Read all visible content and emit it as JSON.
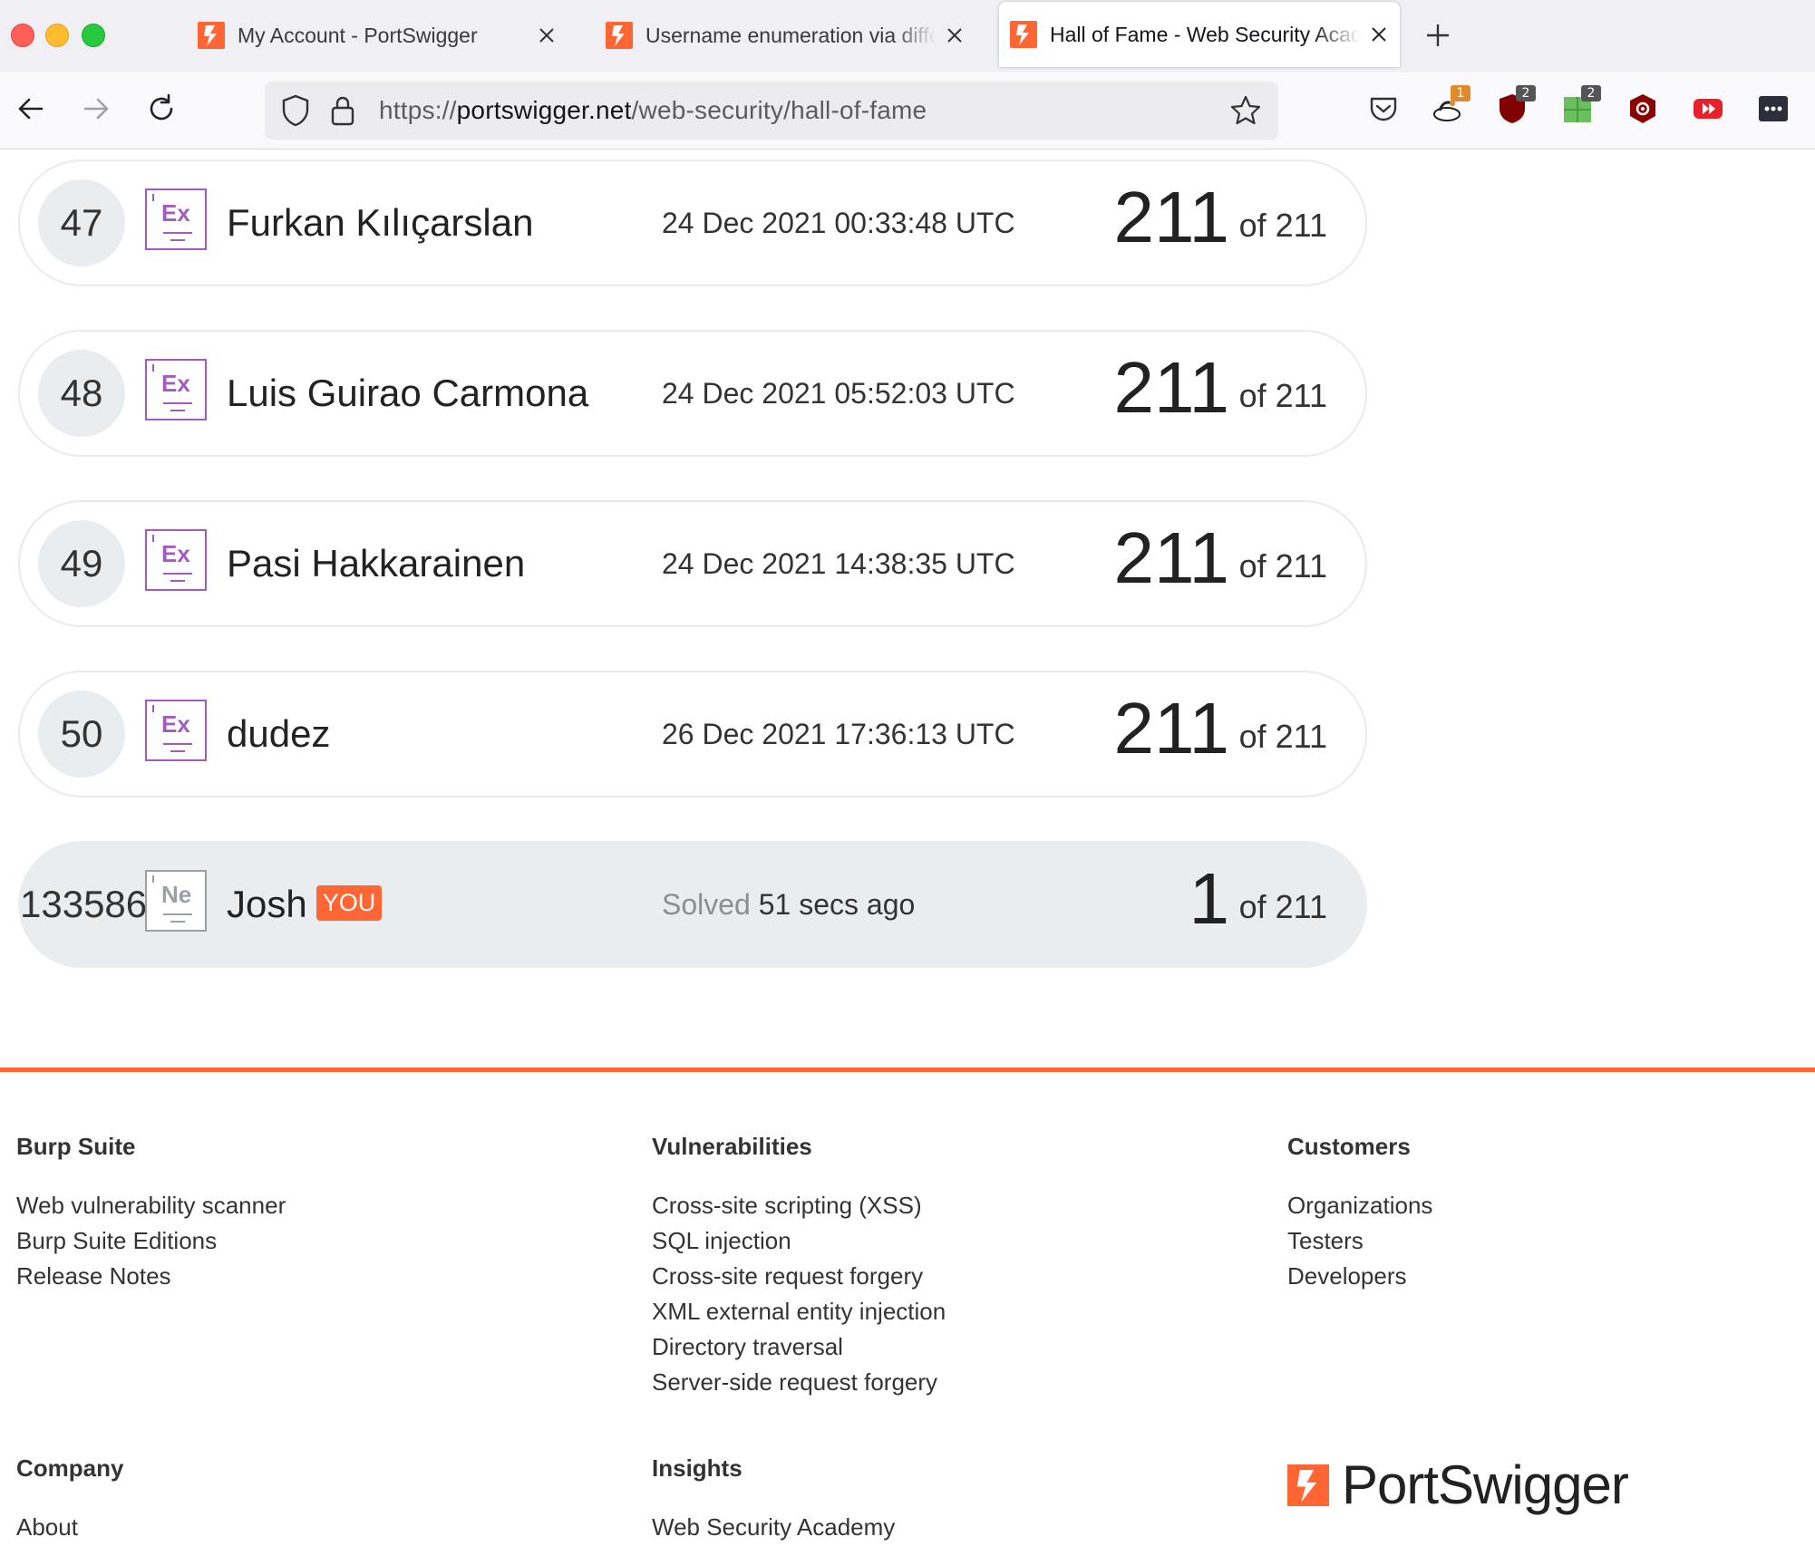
{
  "tabs": [
    {
      "title": "My Account - PortSwigger",
      "active": false
    },
    {
      "title": "Username enumeration via different responses",
      "active": false
    },
    {
      "title": "Hall of Fame - Web Security Academy",
      "active": true
    }
  ],
  "address_bar": {
    "scheme": "https://",
    "host": "portswigger.net",
    "path": "/web-security/hall-of-fame"
  },
  "extensions": [
    {
      "icon": "extension-goose-icon",
      "badge": "1",
      "color": "#e08a2c"
    },
    {
      "icon": "extension-shield-icon",
      "badge": "2",
      "color": "#800000"
    },
    {
      "icon": "extension-green-icon",
      "badge": "2",
      "color": "#5cb85c"
    },
    {
      "icon": "extension-red-hex-icon",
      "badge": "",
      "color": "#8b0000"
    },
    {
      "icon": "extension-play-icon",
      "badge": "",
      "color": "#e8202a"
    },
    {
      "icon": "extension-dots-icon",
      "badge": "",
      "color": "#2b2f3a"
    }
  ],
  "leaderboard": [
    {
      "rank": "47",
      "level": "Ex",
      "name": "Furkan Kılıçarslan",
      "date": "24 Dec 2021 00:33:48 UTC",
      "score": "211",
      "of": "of 211"
    },
    {
      "rank": "48",
      "level": "Ex",
      "name": "Luis Guirao Carmona",
      "date": "24 Dec 2021 05:52:03 UTC",
      "score": "211",
      "of": "of 211"
    },
    {
      "rank": "49",
      "level": "Ex",
      "name": "Pasi Hakkarainen",
      "date": "24 Dec 2021 14:38:35 UTC",
      "score": "211",
      "of": "of 211"
    },
    {
      "rank": "50",
      "level": "Ex",
      "name": "dudez",
      "date": "26 Dec 2021 17:36:13 UTC",
      "score": "211",
      "of": "of 211"
    }
  ],
  "you_row": {
    "rank": "133586",
    "level": "Ne",
    "name": "Josh",
    "tag": "YOU",
    "solved_label": "Solved",
    "solved_time": "51 secs ago",
    "score": "1",
    "of": "of 211"
  },
  "footer": {
    "burp": {
      "heading": "Burp Suite",
      "links": [
        "Web vulnerability scanner",
        "Burp Suite Editions",
        "Release Notes"
      ]
    },
    "vulns": {
      "heading": "Vulnerabilities",
      "links": [
        "Cross-site scripting (XSS)",
        "SQL injection",
        "Cross-site request forgery",
        "XML external entity injection",
        "Directory traversal",
        "Server-side request forgery"
      ]
    },
    "customers": {
      "heading": "Customers",
      "links": [
        "Organizations",
        "Testers",
        "Developers"
      ]
    },
    "company": {
      "heading": "Company",
      "links": [
        "About"
      ]
    },
    "insights": {
      "heading": "Insights",
      "links": [
        "Web Security Academy"
      ]
    },
    "logo_text": "PortSwigger"
  },
  "colors": {
    "accent": "#ff6633",
    "expert_badge": "#a45bc0",
    "row_highlight": "#e9edf0"
  }
}
